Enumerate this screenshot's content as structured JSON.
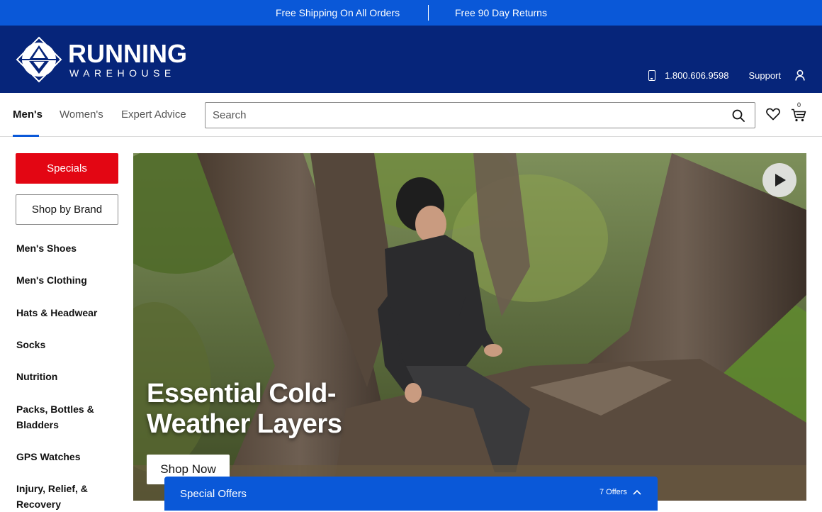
{
  "promo_bar": {
    "items": [
      "Free Shipping On All Orders",
      "Free 90 Day Returns"
    ]
  },
  "header": {
    "logo": {
      "line1": "RUNNING",
      "line2": "WAREHOUSE"
    },
    "phone": "1.800.606.9598",
    "support_label": "Support",
    "icons": [
      "phone-icon",
      "account-icon"
    ]
  },
  "nav": {
    "tabs": [
      {
        "label": "Men's",
        "active": true
      },
      {
        "label": "Women's",
        "active": false
      },
      {
        "label": "Expert Advice",
        "active": false
      }
    ],
    "search": {
      "placeholder": "Search",
      "value": ""
    },
    "cart_count": "0",
    "icons": [
      "search-icon",
      "heart-icon",
      "cart-icon"
    ]
  },
  "sidebar": {
    "specials_label": "Specials",
    "brand_label": "Shop by Brand",
    "items": [
      "Men's Shoes",
      "Men's Clothing",
      "Hats & Headwear",
      "Socks",
      "Nutrition",
      "Packs, Bottles & Bladders",
      "GPS Watches",
      "Injury, Relief, & Recovery"
    ]
  },
  "hero": {
    "title": "Essential Cold-Weather Layers",
    "cta_label": "Shop Now",
    "icons": [
      "play-icon"
    ]
  },
  "offers_bar": {
    "title": "Special Offers",
    "count": "7 Offers",
    "icons": [
      "chevron-up-icon"
    ]
  },
  "colors": {
    "promo_blue": "#0a58d8",
    "header_navy": "#06257a",
    "specials_red": "#e30613"
  }
}
